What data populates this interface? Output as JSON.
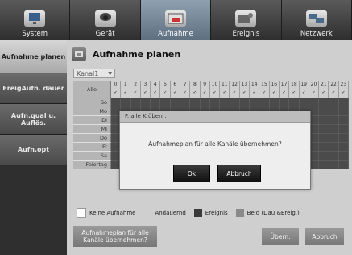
{
  "tabs": [
    {
      "label": "System",
      "icon": "monitor-icon"
    },
    {
      "label": "Gerät",
      "icon": "camera-icon"
    },
    {
      "label": "Aufnahme",
      "icon": "rec-icon"
    },
    {
      "label": "Ereignis",
      "icon": "event-icon"
    },
    {
      "label": "Netzwerk",
      "icon": "network-icon"
    }
  ],
  "sidebar": {
    "items": [
      {
        "label": "Aufnahme planen"
      },
      {
        "label": "EreigAufn. dauer"
      },
      {
        "label": "Aufn.qual u. Auflös."
      },
      {
        "label": "Aufn.opt"
      }
    ]
  },
  "page": {
    "title": "Aufnahme planen",
    "channel": "Kanal1"
  },
  "schedule": {
    "all_label": "Alle",
    "hours": [
      "0",
      "1",
      "2",
      "3",
      "4",
      "5",
      "6",
      "7",
      "8",
      "9",
      "10",
      "11",
      "12",
      "13",
      "14",
      "15",
      "16",
      "17",
      "18",
      "19",
      "20",
      "21",
      "22",
      "23"
    ],
    "days": [
      "So",
      "Mo",
      "Di",
      "Mi",
      "Do",
      "Fr",
      "Sa",
      "Feiertag"
    ]
  },
  "legend": [
    {
      "label": "Keine Aufnahme",
      "color": "#ffffff"
    },
    {
      "label": "Andauernd",
      "color": "#cfcfcf"
    },
    {
      "label": "Ereignis",
      "color": "#3a3a3a"
    },
    {
      "label": "Beid (Dau &Ereig.)",
      "color": "#8a8a8a"
    }
  ],
  "buttons": {
    "apply_all": "Aufnahmeplan für alle Kanäle übernehmen?",
    "ok": "Übern.",
    "cancel": "Abbruch"
  },
  "dialog": {
    "title": "F. alle K übern.",
    "message": "Aufnahmeplan für alle Kanäle übernehmen?",
    "ok": "Ok",
    "cancel": "Abbruch"
  }
}
